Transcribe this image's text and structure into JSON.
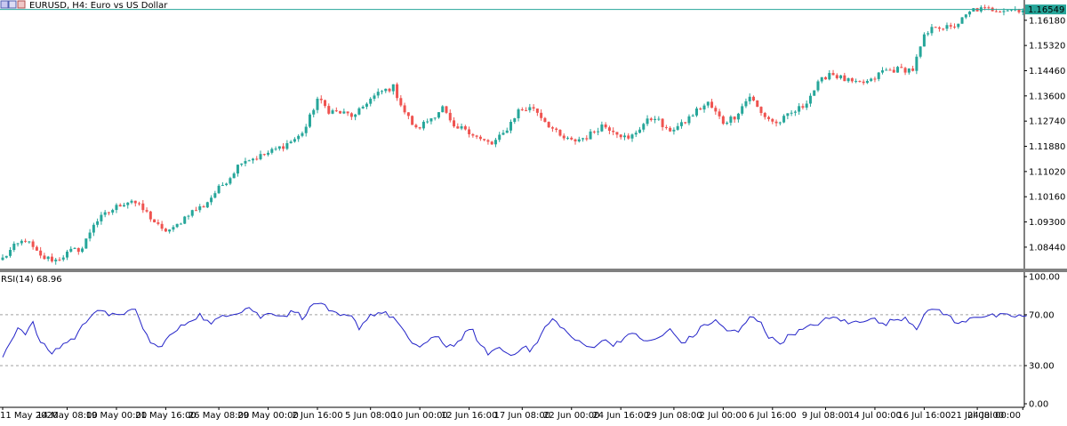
{
  "header": {
    "symbol_title": "EURUSD, H4:  Euro vs US Dollar"
  },
  "price_panel": {
    "current_price_label": "1.16549",
    "price_ticks": [
      "1.16180",
      "1.15320",
      "1.14460",
      "1.13600",
      "1.12740",
      "1.11880",
      "1.11020",
      "1.10160",
      "1.09300",
      "1.08440"
    ]
  },
  "rsi_panel": {
    "label": "RSI(14) 68.96",
    "ticks": [
      "100.00",
      "70.00",
      "30.00",
      "0.00"
    ]
  },
  "time_axis": {
    "labels": [
      "11 May 2020",
      "14 May 08:00",
      "19 May 00:00",
      "21 May 16:00",
      "26 May 08:00",
      "29 May 00:00",
      "2 Jun 16:00",
      "5 Jun 08:00",
      "10 Jun 00:00",
      "12 Jun 16:00",
      "17 Jun 08:00",
      "22 Jun 00:00",
      "24 Jun 16:00",
      "29 Jun 08:00",
      "2 Jul 00:00",
      "6 Jul 16:00",
      "9 Jul 08:00",
      "14 Jul 00:00",
      "16 Jul 16:00",
      "21 Jul 08:00",
      "24 Jul 00:00"
    ]
  },
  "colors": {
    "bull": "#26a69a",
    "bear": "#ef5350",
    "rsi_line": "#2323c8",
    "price_line": "#26a69a",
    "separator": "#808080",
    "level_line": "#a0a0a0"
  },
  "chart_data": [
    {
      "type": "candlestick",
      "title": "EURUSD, H4:  Euro vs US Dollar",
      "ylim": [
        1.078,
        1.1675
      ],
      "y_ticks": [
        1.1618,
        1.1532,
        1.1446,
        1.136,
        1.1274,
        1.1188,
        1.1102,
        1.1016,
        1.093,
        1.0844
      ],
      "current_price": 1.16549,
      "close_anchors": [
        [
          0,
          1.0805
        ],
        [
          3,
          1.0845
        ],
        [
          6,
          1.087
        ],
        [
          10,
          1.081
        ],
        [
          14,
          1.08
        ],
        [
          18,
          1.083
        ],
        [
          21,
          1.084
        ],
        [
          24,
          1.0925
        ],
        [
          27,
          1.0955
        ],
        [
          31,
          1.099
        ],
        [
          34,
          1.1005
        ],
        [
          38,
          1.096
        ],
        [
          42,
          1.09
        ],
        [
          45,
          1.0905
        ],
        [
          49,
          1.096
        ],
        [
          53,
          1.0985
        ],
        [
          56,
          1.103
        ],
        [
          60,
          1.1085
        ],
        [
          63,
          1.114
        ],
        [
          67,
          1.115
        ],
        [
          70,
          1.1165
        ],
        [
          74,
          1.119
        ],
        [
          78,
          1.122
        ],
        [
          80,
          1.1255
        ],
        [
          83,
          1.135
        ],
        [
          86,
          1.131
        ],
        [
          90,
          1.13
        ],
        [
          93,
          1.129
        ],
        [
          96,
          1.134
        ],
        [
          100,
          1.1375
        ],
        [
          103,
          1.139
        ],
        [
          106,
          1.1305
        ],
        [
          109,
          1.1245
        ],
        [
          113,
          1.1285
        ],
        [
          116,
          1.132
        ],
        [
          119,
          1.1245
        ],
        [
          122,
          1.125
        ],
        [
          126,
          1.121
        ],
        [
          129,
          1.1195
        ],
        [
          132,
          1.123
        ],
        [
          136,
          1.131
        ],
        [
          140,
          1.132
        ],
        [
          143,
          1.1275
        ],
        [
          147,
          1.122
        ],
        [
          150,
          1.1205
        ],
        [
          154,
          1.122
        ],
        [
          158,
          1.126
        ],
        [
          161,
          1.1245
        ],
        [
          165,
          1.121
        ],
        [
          169,
          1.1265
        ],
        [
          172,
          1.129
        ],
        [
          175,
          1.124
        ],
        [
          179,
          1.126
        ],
        [
          183,
          1.131
        ],
        [
          186,
          1.1335
        ],
        [
          190,
          1.127
        ],
        [
          193,
          1.129
        ],
        [
          197,
          1.136
        ],
        [
          200,
          1.13
        ],
        [
          204,
          1.1265
        ],
        [
          208,
          1.13
        ],
        [
          211,
          1.1325
        ],
        [
          215,
          1.14
        ],
        [
          218,
          1.144
        ],
        [
          222,
          1.1415
        ],
        [
          225,
          1.14
        ],
        [
          229,
          1.141
        ],
        [
          232,
          1.1445
        ],
        [
          236,
          1.145
        ],
        [
          240,
          1.145
        ],
        [
          243,
          1.156
        ],
        [
          246,
          1.16
        ],
        [
          250,
          1.159
        ],
        [
          253,
          1.162
        ],
        [
          256,
          1.1655
        ]
      ],
      "x_label_candles": [
        0,
        17,
        30,
        43,
        57,
        70,
        83,
        97,
        110,
        123,
        137,
        150,
        163,
        177,
        190,
        203,
        217,
        230,
        243,
        257,
        269
      ]
    },
    {
      "type": "line",
      "series": [
        {
          "name": "RSI(14)",
          "last_value": 68.96
        }
      ],
      "ylim": [
        0,
        100
      ],
      "levels": [
        70,
        30
      ],
      "y_ticks": [
        100,
        70,
        30,
        0
      ],
      "anchors": [
        [
          0,
          37
        ],
        [
          2,
          49
        ],
        [
          4,
          60
        ],
        [
          6,
          56
        ],
        [
          8,
          63
        ],
        [
          10,
          48
        ],
        [
          13,
          40
        ],
        [
          16,
          47
        ],
        [
          19,
          52
        ],
        [
          22,
          65
        ],
        [
          24,
          73
        ],
        [
          26,
          74
        ],
        [
          28,
          68
        ],
        [
          30,
          71
        ],
        [
          33,
          72
        ],
        [
          35,
          73
        ],
        [
          37,
          60
        ],
        [
          39,
          48
        ],
        [
          41,
          44
        ],
        [
          43,
          50
        ],
        [
          46,
          58
        ],
        [
          49,
          65
        ],
        [
          52,
          70
        ],
        [
          55,
          62
        ],
        [
          58,
          70
        ],
        [
          62,
          72
        ],
        [
          65,
          76
        ],
        [
          68,
          68
        ],
        [
          71,
          72
        ],
        [
          74,
          69
        ],
        [
          77,
          73
        ],
        [
          79,
          68
        ],
        [
          82,
          78
        ],
        [
          84,
          80
        ],
        [
          86,
          72
        ],
        [
          89,
          69
        ],
        [
          92,
          68
        ],
        [
          94,
          60
        ],
        [
          97,
          70
        ],
        [
          100,
          72
        ],
        [
          103,
          68
        ],
        [
          105,
          60
        ],
        [
          107,
          50
        ],
        [
          110,
          45
        ],
        [
          113,
          50
        ],
        [
          115,
          53
        ],
        [
          117,
          45
        ],
        [
          120,
          48
        ],
        [
          122,
          55
        ],
        [
          124,
          58
        ],
        [
          126,
          45
        ],
        [
          128,
          40
        ],
        [
          131,
          44
        ],
        [
          134,
          38
        ],
        [
          137,
          45
        ],
        [
          139,
          42
        ],
        [
          141,
          48
        ],
        [
          143,
          60
        ],
        [
          145,
          66
        ],
        [
          147,
          62
        ],
        [
          149,
          55
        ],
        [
          152,
          48
        ],
        [
          155,
          44
        ],
        [
          158,
          50
        ],
        [
          161,
          47
        ],
        [
          164,
          52
        ],
        [
          167,
          55
        ],
        [
          170,
          48
        ],
        [
          173,
          52
        ],
        [
          176,
          58
        ],
        [
          179,
          48
        ],
        [
          182,
          53
        ],
        [
          185,
          62
        ],
        [
          188,
          65
        ],
        [
          191,
          58
        ],
        [
          194,
          56
        ],
        [
          197,
          68
        ],
        [
          200,
          65
        ],
        [
          202,
          52
        ],
        [
          205,
          48
        ],
        [
          208,
          55
        ],
        [
          211,
          58
        ],
        [
          214,
          62
        ],
        [
          217,
          66
        ],
        [
          220,
          68
        ],
        [
          223,
          63
        ],
        [
          226,
          65
        ],
        [
          229,
          68
        ],
        [
          232,
          62
        ],
        [
          235,
          66
        ],
        [
          238,
          68
        ],
        [
          241,
          60
        ],
        [
          243,
          70
        ],
        [
          246,
          75
        ],
        [
          249,
          70
        ],
        [
          252,
          62
        ],
        [
          254,
          66
        ],
        [
          256,
          69
        ]
      ]
    }
  ]
}
